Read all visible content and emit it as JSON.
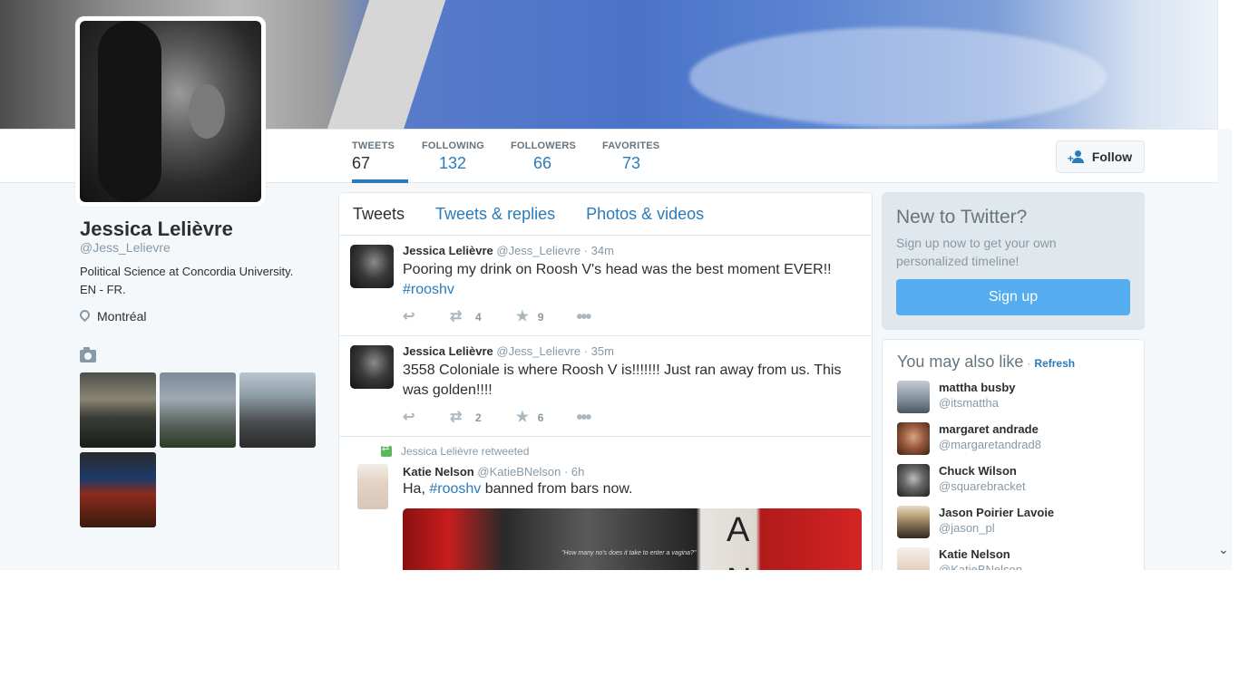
{
  "profile": {
    "name": "Jessica Lelièvre",
    "handle": "@Jess_Lelievre",
    "bio": "Political Science at Concordia University.\nEN - FR.",
    "location": "Montréal"
  },
  "nav": {
    "stats": [
      {
        "label": "TWEETS",
        "value": "67"
      },
      {
        "label": "FOLLOWING",
        "value": "132"
      },
      {
        "label": "FOLLOWERS",
        "value": "66"
      },
      {
        "label": "FAVORITES",
        "value": "73"
      }
    ],
    "follow_label": "Follow"
  },
  "stream": {
    "tabs": [
      "Tweets",
      "Tweets & replies",
      "Photos & videos"
    ],
    "tweets": [
      {
        "name": "Jessica Lelièvre",
        "handle": "@Jess_Lelievre",
        "time": "· 34m",
        "text": "Pooring my drink on Roosh V's head was the best moment EVER!!",
        "hashtag": "#rooshv",
        "retweets": "4",
        "favorites": "9"
      },
      {
        "name": "Jessica Lelièvre",
        "handle": "@Jess_Lelievre",
        "time": "· 35m",
        "text": "3558 Coloniale is where Roosh V is!!!!!!! Just ran away from us. This was golden!!!!",
        "retweets": "2",
        "favorites": "6"
      },
      {
        "retweeted_by": "Jessica Lelièvre retweeted",
        "name": "Katie Nelson",
        "handle": "@KatieBNelson",
        "time": "· 6h",
        "text_before": "Ha, ",
        "hashtag": "#rooshv",
        "text_after": " banned from bars now.",
        "media_caption": "\"How many no's does it take to enter a vagina?\"",
        "media_letters": "A\nN"
      }
    ]
  },
  "signup": {
    "title": "New to Twitter?",
    "description": "Sign up now to get your own personalized timeline!",
    "button": "Sign up"
  },
  "suggestions": {
    "title": "You may also like",
    "separator": "·",
    "refresh": "Refresh",
    "users": [
      {
        "name": "mattha busby",
        "handle": "@itsmattha",
        "color": "#7f8c99"
      },
      {
        "name": "margaret andrade",
        "handle": "@margaretandrad8",
        "color": "#9a5a3c"
      },
      {
        "name": "Chuck Wilson",
        "handle": "@squarebracket",
        "color": "#3d3d3d"
      },
      {
        "name": "Jason Poirier Lavoie",
        "handle": "@jason_pl",
        "color": "#6b5a46"
      },
      {
        "name": "Katie Nelson",
        "handle": "@KatieBNelson",
        "color": "#e6d6c8"
      }
    ]
  },
  "colors": {
    "accent": "#2b7bb9",
    "signup_button": "#55acee",
    "text_muted": "#8899a6"
  }
}
